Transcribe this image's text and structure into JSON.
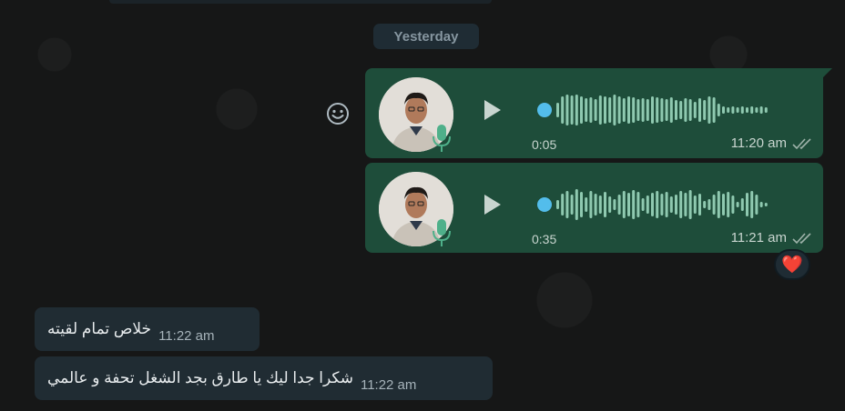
{
  "date_divider": "Yesterday",
  "voice_messages": [
    {
      "duration": "0:05",
      "time": "11:20 am"
    },
    {
      "duration": "0:35",
      "time": "11:21 am"
    }
  ],
  "reaction": "❤️",
  "incoming": [
    {
      "text": "خلاص تمام لقيته",
      "time": "11:22 am"
    },
    {
      "text": "شكرا جدا ليك يا طارق بجد الشغل تحفة و عالمي",
      "time": "11:22 am"
    }
  ],
  "colors": {
    "outgoing_bubble": "#1e4d3a",
    "incoming_bubble": "#202c33",
    "waveform": "#8fc9b0",
    "waveform_dot": "#53bdeb"
  },
  "icons": [
    "smiley-icon",
    "play-icon",
    "mic-icon",
    "double-check-icon",
    "heart-icon"
  ]
}
